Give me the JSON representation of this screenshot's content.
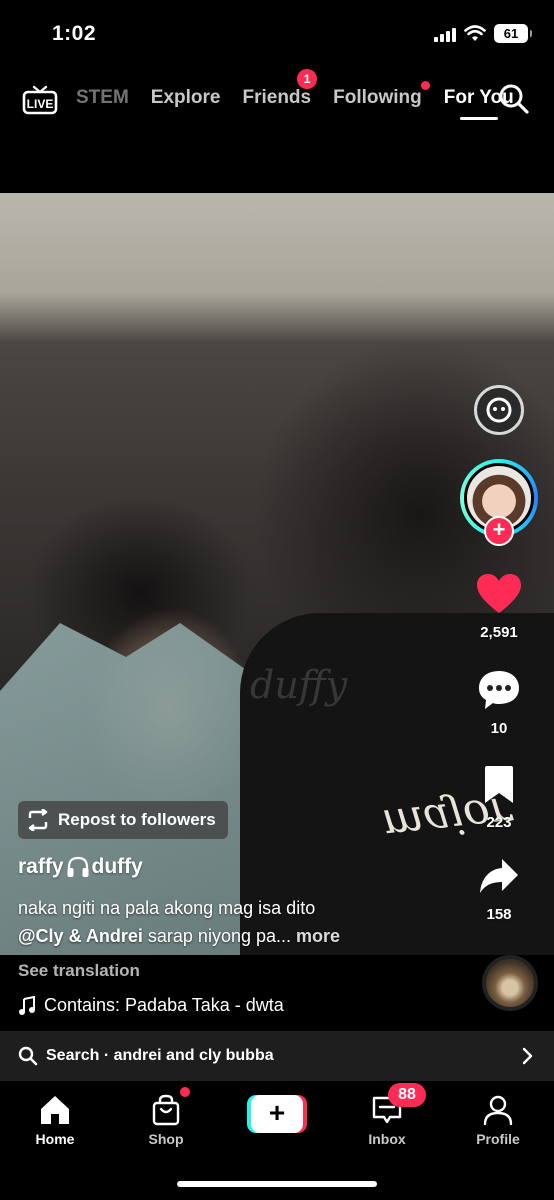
{
  "status_bar": {
    "time": "1:02",
    "battery": "61"
  },
  "top_nav": {
    "tabs": [
      {
        "label": "STEM"
      },
      {
        "label": "Explore"
      },
      {
        "label": "Friends",
        "badge": "1"
      },
      {
        "label": "Following"
      },
      {
        "label": "For You",
        "active": true
      }
    ]
  },
  "rail": {
    "likes": "2,591",
    "comments": "10",
    "saves": "223",
    "shares": "158"
  },
  "video": {
    "watermark": "duffy",
    "shirt_print": "major"
  },
  "post": {
    "repost_label": "Repost to followers",
    "author_part1": "raffy",
    "author_part2": "duffy",
    "caption_line1": "naka ngiti na pala akong mag isa dito",
    "caption_mention": "@Cly & Andrei",
    "caption_rest": " sarap niyong pa...",
    "more": "more",
    "see_translation": "See translation",
    "music": "Contains: Padaba Taka - dwta"
  },
  "search_bar": {
    "text": "Search · andrei and cly bubba"
  },
  "bottom_nav": {
    "home": "Home",
    "shop": "Shop",
    "inbox": "Inbox",
    "inbox_badge": "88",
    "profile": "Profile"
  },
  "colors": {
    "accent": "#fe2c55",
    "cyan": "#25f4ee"
  }
}
